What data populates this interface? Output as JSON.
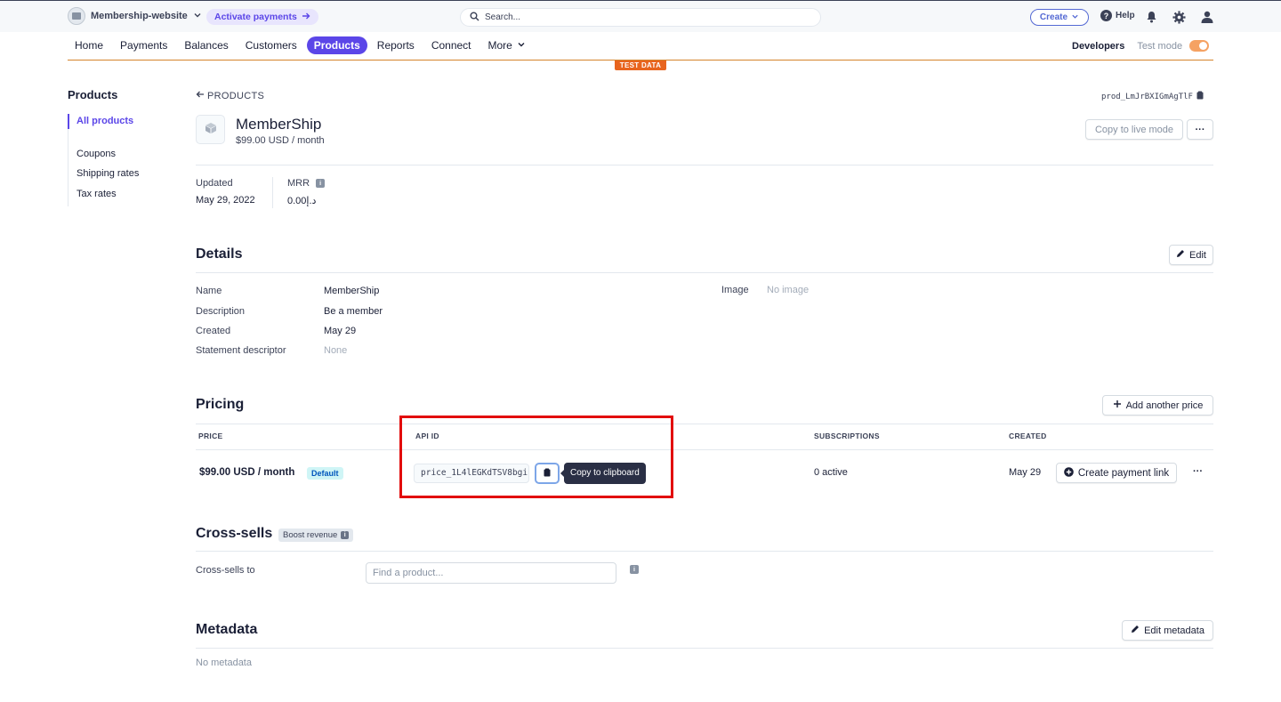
{
  "topbar": {
    "account_name": "Membership-website",
    "activate_label": "Activate payments",
    "search_placeholder": "Search...",
    "create_label": "Create",
    "help_label": "Help"
  },
  "nav": {
    "items": [
      "Home",
      "Payments",
      "Balances",
      "Customers",
      "Products",
      "Reports",
      "Connect",
      "More"
    ],
    "active": "Products",
    "developers_label": "Developers",
    "test_mode_label": "Test mode",
    "test_data_badge": "TEST DATA"
  },
  "sidebar": {
    "title": "Products",
    "items": [
      "All products",
      "Coupons",
      "Shipping rates",
      "Tax rates"
    ]
  },
  "product": {
    "back_label": "PRODUCTS",
    "id": "prod_LmJrBXIGmAgTlF",
    "name": "MemberShip",
    "price": "$99.00 USD / month",
    "copy_live_label": "Copy to live mode",
    "more_label": "···",
    "updated_label": "Updated",
    "updated_value": "May 29, 2022",
    "mrr_label": "MRR",
    "mrr_value": "د.إ0.00"
  },
  "details": {
    "title": "Details",
    "edit_label": "Edit",
    "rows": [
      {
        "label": "Name",
        "value": "MemberShip"
      },
      {
        "label": "Description",
        "value": "Be a member"
      },
      {
        "label": "Created",
        "value": "May 29"
      },
      {
        "label": "Statement descriptor",
        "value": "None"
      }
    ],
    "image_label": "Image",
    "image_value": "No image"
  },
  "pricing": {
    "title": "Pricing",
    "add_price_label": "Add another price",
    "columns": [
      "PRICE",
      "API ID",
      "SUBSCRIPTIONS",
      "CREATED"
    ],
    "row": {
      "price": "$99.00 USD / month",
      "badge": "Default",
      "api_id": "price_1L4lEGKdTSV8bgi",
      "copy_tooltip": "Copy to clipboard",
      "subscriptions": "0 active",
      "created": "May 29",
      "payment_link_label": "Create payment link",
      "more_label": "···"
    }
  },
  "cross_sells": {
    "title": "Cross-sells",
    "badge": "Boost revenue",
    "label": "Cross-sells to",
    "placeholder": "Find a product..."
  },
  "metadata": {
    "title": "Metadata",
    "edit_label": "Edit metadata",
    "empty": "No metadata"
  },
  "colors": {
    "accent": "#5b46e8",
    "test_orange": "#e8641e",
    "highlight_red": "#e20b0b"
  }
}
